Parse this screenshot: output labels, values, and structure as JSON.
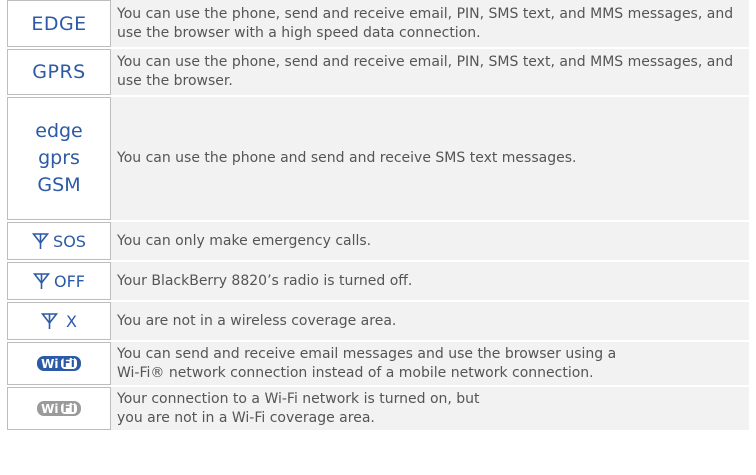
{
  "rows": [
    {
      "icon": "EDGE",
      "text": "You can use the phone, send and receive email, PIN, SMS text, and MMS messages, and use the browser with a high speed data connection."
    },
    {
      "icon": "GPRS",
      "text": "You can use the phone, send and receive email, PIN, SMS text, and MMS messages, and use the browser."
    },
    {
      "icon_lines": [
        "edge",
        "gprs",
        "GSM"
      ],
      "text": "You can use the phone and send and receive SMS text messages."
    },
    {
      "icon": "signal-antenna-icon",
      "icon_label": "SOS",
      "text": "You can only make emergency calls."
    },
    {
      "icon": "signal-antenna-icon",
      "icon_label": "OFF",
      "text": "Your BlackBerry 8820’s radio is turned off."
    },
    {
      "icon": "signal-antenna-icon",
      "icon_label": "X",
      "text": "You are not in a wireless coverage area."
    },
    {
      "icon": "wifi-on-icon",
      "badge_a": "Wi",
      "badge_b": "Fi",
      "text": "You can send and receive email messages and use the browser using a Wi-Fi® network connection instead of a mobile network connection."
    },
    {
      "icon": "wifi-off-icon",
      "badge_a": "Wi",
      "badge_b": "Fi",
      "text": "Your connection to a Wi-Fi network is turned on, but you are not in a Wi-Fi coverage area."
    }
  ],
  "colors": {
    "accent": "#2c5aa6",
    "inactive": "#9b9b9b",
    "text": "#555555",
    "row_bg": "#f2f2f2"
  }
}
